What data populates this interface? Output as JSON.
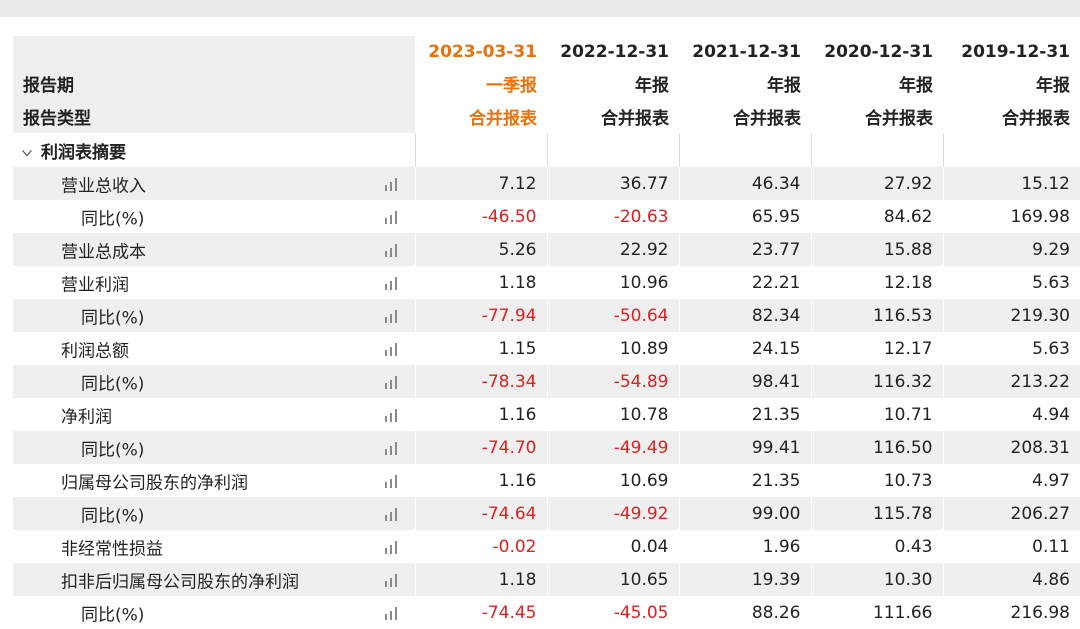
{
  "header": {
    "label_period": "报告期",
    "label_type": "报告类型",
    "columns": [
      {
        "date": "2023-03-31",
        "period": "一季报",
        "type": "合并报表"
      },
      {
        "date": "2022-12-31",
        "period": "年报",
        "type": "合并报表"
      },
      {
        "date": "2021-12-31",
        "period": "年报",
        "type": "合并报表"
      },
      {
        "date": "2020-12-31",
        "period": "年报",
        "type": "合并报表"
      },
      {
        "date": "2019-12-31",
        "period": "年报",
        "type": "合并报表"
      }
    ]
  },
  "section": {
    "title": "利润表摘要"
  },
  "rows": [
    {
      "label": "营业总收入",
      "values": [
        "7.12",
        "36.77",
        "46.34",
        "27.92",
        "15.12"
      ]
    },
    {
      "label": "同比(%)",
      "values": [
        "-46.50",
        "-20.63",
        "65.95",
        "84.62",
        "169.98"
      ]
    },
    {
      "label": "营业总成本",
      "values": [
        "5.26",
        "22.92",
        "23.77",
        "15.88",
        "9.29"
      ]
    },
    {
      "label": "营业利润",
      "values": [
        "1.18",
        "10.96",
        "22.21",
        "12.18",
        "5.63"
      ]
    },
    {
      "label": "同比(%)",
      "values": [
        "-77.94",
        "-50.64",
        "82.34",
        "116.53",
        "219.30"
      ]
    },
    {
      "label": "利润总额",
      "values": [
        "1.15",
        "10.89",
        "24.15",
        "12.17",
        "5.63"
      ]
    },
    {
      "label": "同比(%)",
      "values": [
        "-78.34",
        "-54.89",
        "98.41",
        "116.32",
        "213.22"
      ]
    },
    {
      "label": "净利润",
      "values": [
        "1.16",
        "10.78",
        "21.35",
        "10.71",
        "4.94"
      ]
    },
    {
      "label": "同比(%)",
      "values": [
        "-74.70",
        "-49.49",
        "99.41",
        "116.50",
        "208.31"
      ]
    },
    {
      "label": "归属母公司股东的净利润",
      "values": [
        "1.16",
        "10.69",
        "21.35",
        "10.73",
        "4.97"
      ]
    },
    {
      "label": "同比(%)",
      "values": [
        "-74.64",
        "-49.92",
        "99.00",
        "115.78",
        "206.27"
      ]
    },
    {
      "label": "非经常性损益",
      "values": [
        "-0.02",
        "0.04",
        "1.96",
        "0.43",
        "0.11"
      ]
    },
    {
      "label": "扣非后归属母公司股东的净利润",
      "values": [
        "1.18",
        "10.65",
        "19.39",
        "10.30",
        "4.86"
      ]
    },
    {
      "label": "同比(%)",
      "values": [
        "-74.45",
        "-45.05",
        "88.26",
        "111.66",
        "216.98"
      ]
    }
  ],
  "colors": {
    "accent_orange": "#e8720c",
    "negative_red": "#e02020",
    "shade": "#efefef"
  },
  "icons": {
    "chart": "bar-chart-icon",
    "collapse": "chevron-down-icon"
  }
}
